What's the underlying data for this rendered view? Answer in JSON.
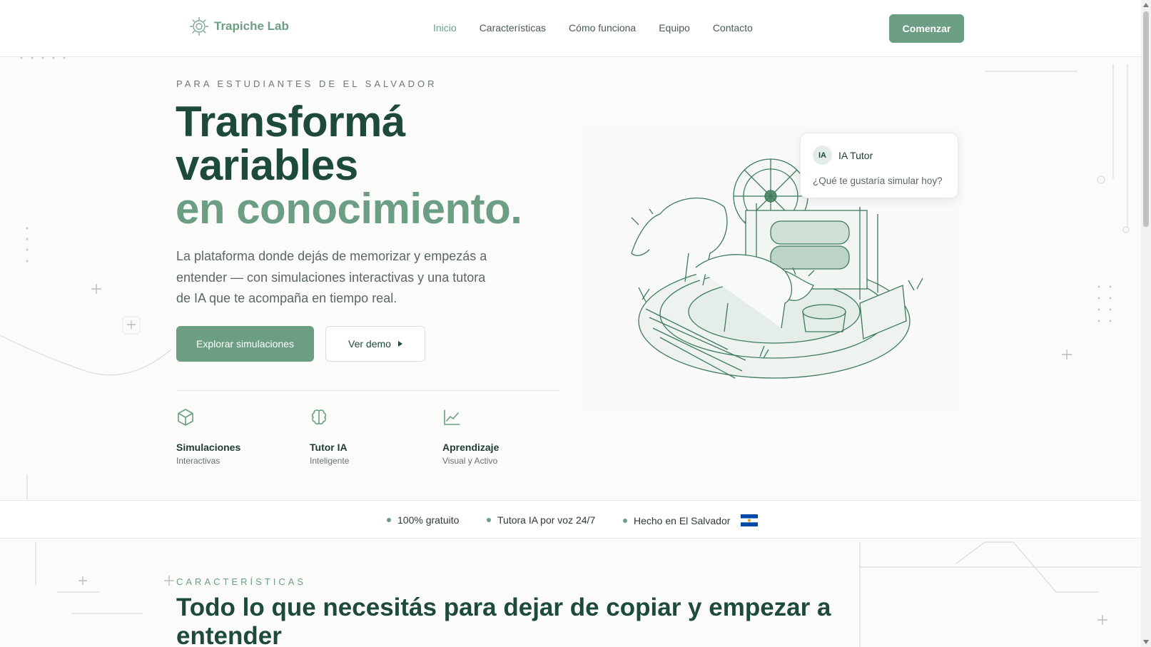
{
  "header": {
    "logo_text": "Trapiche Lab",
    "nav": [
      {
        "label": "Inicio",
        "active": true
      },
      {
        "label": "Características",
        "active": false
      },
      {
        "label": "Cómo funciona",
        "active": false
      },
      {
        "label": "Equipo",
        "active": false
      },
      {
        "label": "Contacto",
        "active": false
      }
    ],
    "cta_label": "Comenzar"
  },
  "hero": {
    "eyebrow": "PARA ESTUDIANTES DE EL SALVADOR",
    "title_line1": "Transformá",
    "title_line2": "variables",
    "title_line3": "en conocimiento.",
    "lead": "La plataforma donde dejás de memorizar y empezás a entender — con simulaciones interactivas y una tutora de IA que te acompaña en tiempo real.",
    "primary_button": "Explorar simulaciones",
    "secondary_button": "Ver demo",
    "features": [
      {
        "title": "Simulaciones",
        "subtitle": "Interactivas",
        "icon": "cube-icon"
      },
      {
        "title": "Tutor IA",
        "subtitle": "Inteligente",
        "icon": "brain-icon"
      },
      {
        "title": "Aprendizaje",
        "subtitle": "Visual y Activo",
        "icon": "chart-line-icon"
      }
    ]
  },
  "chat": {
    "avatar": "IA",
    "name": "IA Tutor",
    "message": "¿Qué te gustaría simular hoy?"
  },
  "strip": {
    "badges": [
      "100% gratuito",
      "Tutora IA por voz 24/7",
      "Hecho en El Salvador"
    ]
  },
  "features_section": {
    "eyebrow": "CARACTERÍSTICAS",
    "title": "Todo lo que necesitás para dejar de copiar y empezar a entender"
  },
  "colors": {
    "brand": "#6c9e83",
    "dark": "#1e4a3c"
  }
}
